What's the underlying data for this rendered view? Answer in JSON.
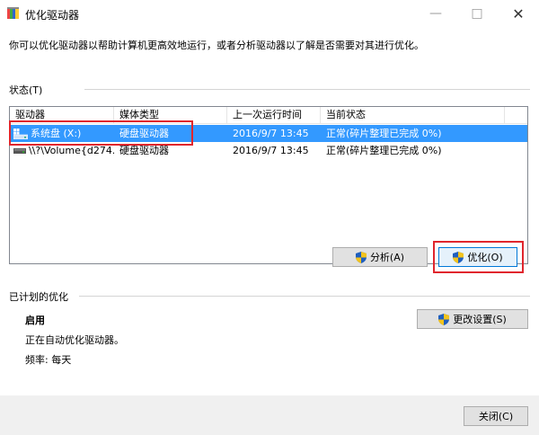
{
  "window": {
    "title": "优化驱动器",
    "minimize_glyph": "—",
    "maximize_glyph": "□",
    "close_glyph": "✕"
  },
  "description": "你可以优化驱动器以帮助计算机更高效地运行，或者分析驱动器以了解是否需要对其进行优化。",
  "status": {
    "label": "状态(T)",
    "columns": [
      "驱动器",
      "媒体类型",
      "上一次运行时间",
      "当前状态"
    ],
    "rows": [
      {
        "drive": "系统盘 (X:)",
        "media": "硬盘驱动器",
        "last_run": "2016/9/7 13:45",
        "status": "正常(碎片整理已完成 0%)",
        "selected": true,
        "icon": "system-drive-icon"
      },
      {
        "drive": "\\\\?\\Volume{d274...",
        "media": "硬盘驱动器",
        "last_run": "2016/9/7 13:45",
        "status": "正常(碎片整理已完成 0%)",
        "selected": false,
        "icon": "hard-drive-icon"
      }
    ]
  },
  "actions": {
    "analyze_label": "分析(A)",
    "optimize_label": "优化(O)"
  },
  "schedule": {
    "label": "已计划的优化",
    "state": "启用",
    "detail": "正在自动优化驱动器。",
    "frequency": "频率: 每天",
    "change_settings_label": "更改设置(S)"
  },
  "footer": {
    "close_label": "关闭(C)"
  },
  "colors": {
    "selection": "#3399ff",
    "highlight_box": "#e0262d",
    "shield_blue": "#1f5fbf",
    "shield_yellow": "#f2c31d"
  }
}
